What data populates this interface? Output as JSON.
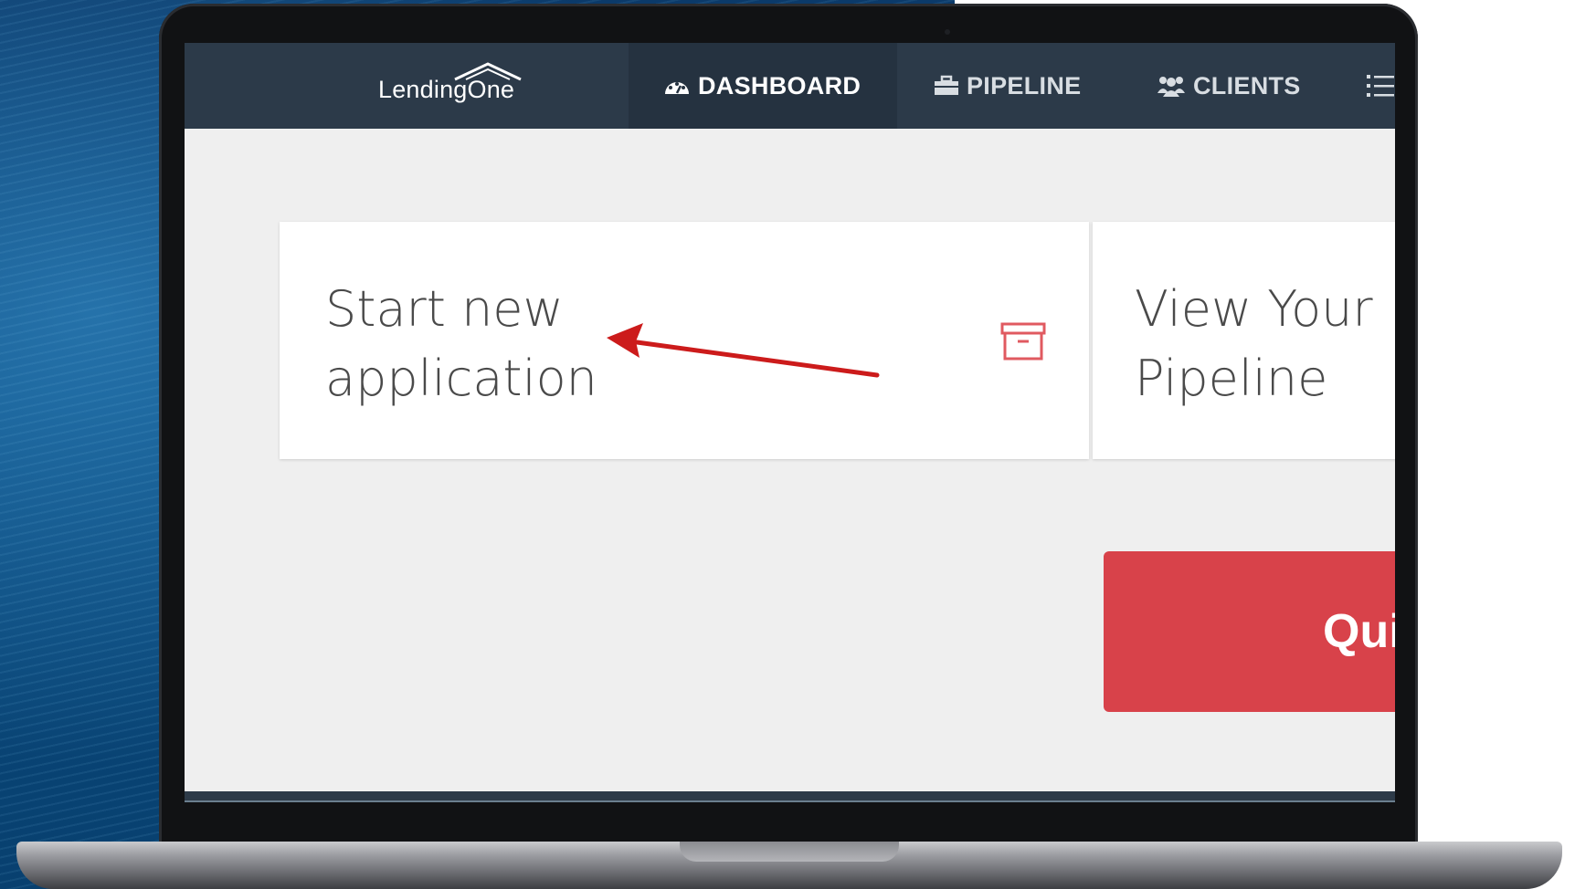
{
  "app": {
    "logo_text": "LendingOne"
  },
  "nav": {
    "items": [
      {
        "label": "DASHBOARD",
        "icon": "speedometer-icon",
        "active": true
      },
      {
        "label": "PIPELINE",
        "icon": "briefcase-icon",
        "active": false
      },
      {
        "label": "CLIENTS",
        "icon": "users-icon",
        "active": false
      }
    ],
    "more_icon": "list-icon"
  },
  "cards": [
    {
      "title": "Start new\napplication",
      "icon": "archive-icon"
    },
    {
      "title": "View Your\nPipeline"
    }
  ],
  "quick_button": {
    "label": "Qui"
  },
  "colors": {
    "navbar": "#2c3a49",
    "accent_red": "#d8424a",
    "page_bg": "#efefef",
    "backdrop_blue": "#0a4a7e"
  }
}
